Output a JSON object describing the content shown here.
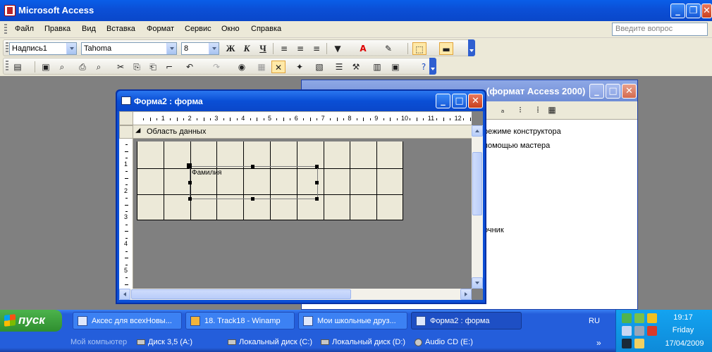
{
  "window": {
    "title": "Microsoft Access"
  },
  "menu": {
    "items": [
      "Файл",
      "Правка",
      "Вид",
      "Вставка",
      "Формат",
      "Сервис",
      "Окно",
      "Справка"
    ],
    "help_placeholder": "Введите вопрос"
  },
  "format_toolbar": {
    "object": "Надпись1",
    "font": "Tahoma",
    "size": "8",
    "bold": "Ж",
    "italic": "К",
    "underline": "Ч"
  },
  "db_window": {
    "title": "(формат Access 2000)",
    "rows": [
      "режиме конструктора",
      "помощью мастера",
      "очник"
    ]
  },
  "form_window": {
    "title": "Форма2 : форма",
    "section": "Область данных",
    "label_text": "Фамилия",
    "ruler_h": [
      "1",
      "2",
      "3",
      "4",
      "5",
      "6",
      "7",
      "8",
      "9",
      "10",
      "11",
      "12"
    ],
    "ruler_v": [
      "1",
      "2",
      "3",
      "4",
      "5"
    ]
  },
  "taskbar": {
    "start": "пуск",
    "tasks": [
      "Аксес для всехНовы...",
      "18. Track18 - Winamp",
      "Мои школьные друз...",
      "Форма2 : форма"
    ],
    "lang": "RU",
    "clock_time": "19:17",
    "clock_day": "Friday",
    "clock_date": "17/04/2009",
    "drives": [
      "Мой компьютер",
      "Диск 3,5 (A:)",
      "Локальный диск (C:)",
      "Локальный диск (D:)",
      "Audio CD (E:)"
    ]
  },
  "colors": {
    "title_blue": "#0a4fd6",
    "close_red": "#c9401c",
    "taskbar": "#245edb",
    "start_green": "#3a9c3a",
    "design_bg": "#ece9d8"
  }
}
